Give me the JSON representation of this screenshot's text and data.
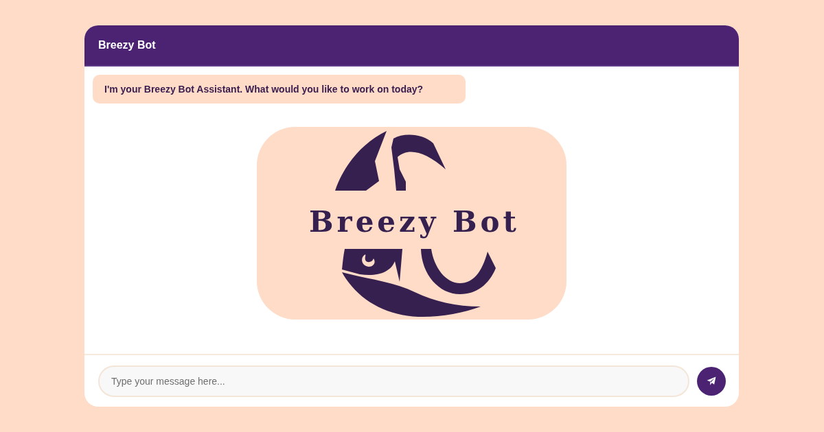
{
  "header": {
    "title": "Breezy Bot"
  },
  "messages": [
    {
      "kind": "text",
      "text": "I'm your Breezy Bot Assistant. What would you like to work on today?"
    },
    {
      "kind": "logo",
      "text": "Breezy Bot"
    }
  ],
  "composer": {
    "placeholder": "Type your message here..."
  }
}
